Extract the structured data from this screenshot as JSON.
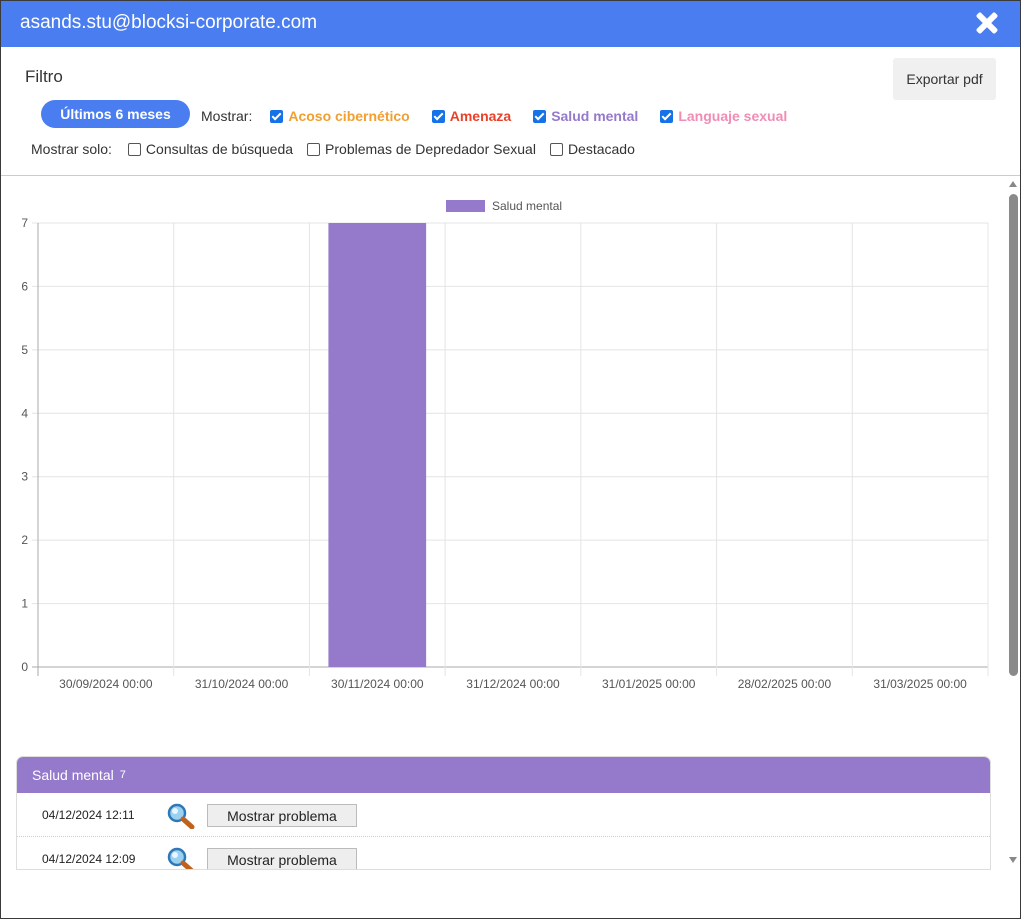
{
  "window": {
    "title": "asands.stu@blocksi-corporate.com"
  },
  "toolbar": {
    "filter_label": "Filtro",
    "export_label": "Exportar pdf",
    "period_label": "Últimos 6 meses"
  },
  "show": {
    "label": "Mostrar:",
    "options": [
      {
        "label": "Acoso cibernético",
        "checked": true,
        "color": "#f0a030"
      },
      {
        "label": "Amenaza",
        "checked": true,
        "color": "#e8412a"
      },
      {
        "label": "Salud mental",
        "checked": true,
        "color": "#9579cb"
      },
      {
        "label": "Languaje sexual",
        "checked": true,
        "color": "#f08cb5"
      }
    ]
  },
  "show_only": {
    "label": "Mostrar solo:",
    "options": [
      {
        "label": "Consultas de búsqueda",
        "checked": false
      },
      {
        "label": "Problemas de Depredador Sexual",
        "checked": false
      },
      {
        "label": "Destacado",
        "checked": false
      }
    ]
  },
  "chart_data": {
    "type": "bar",
    "categories": [
      "30/09/2024 00:00",
      "31/10/2024 00:00",
      "30/11/2024 00:00",
      "31/12/2024 00:00",
      "31/01/2025 00:00",
      "28/02/2025 00:00",
      "31/03/2025 00:00"
    ],
    "series": [
      {
        "name": "Salud mental",
        "color": "#9579cb",
        "values": [
          0,
          0,
          7,
          0,
          0,
          0,
          0
        ]
      }
    ],
    "yticks": [
      "0",
      "1",
      "2",
      "3",
      "4",
      "5",
      "6",
      "7"
    ],
    "ylim": [
      0,
      7
    ],
    "grid": true,
    "legend": "top-center"
  },
  "panel": {
    "title": "Salud mental",
    "count": "7",
    "color": "#9579cb",
    "rows": [
      {
        "date": "04/12/2024 12:11",
        "button": "Mostrar problema"
      },
      {
        "date": "04/12/2024 12:09",
        "button": "Mostrar problema"
      }
    ]
  }
}
